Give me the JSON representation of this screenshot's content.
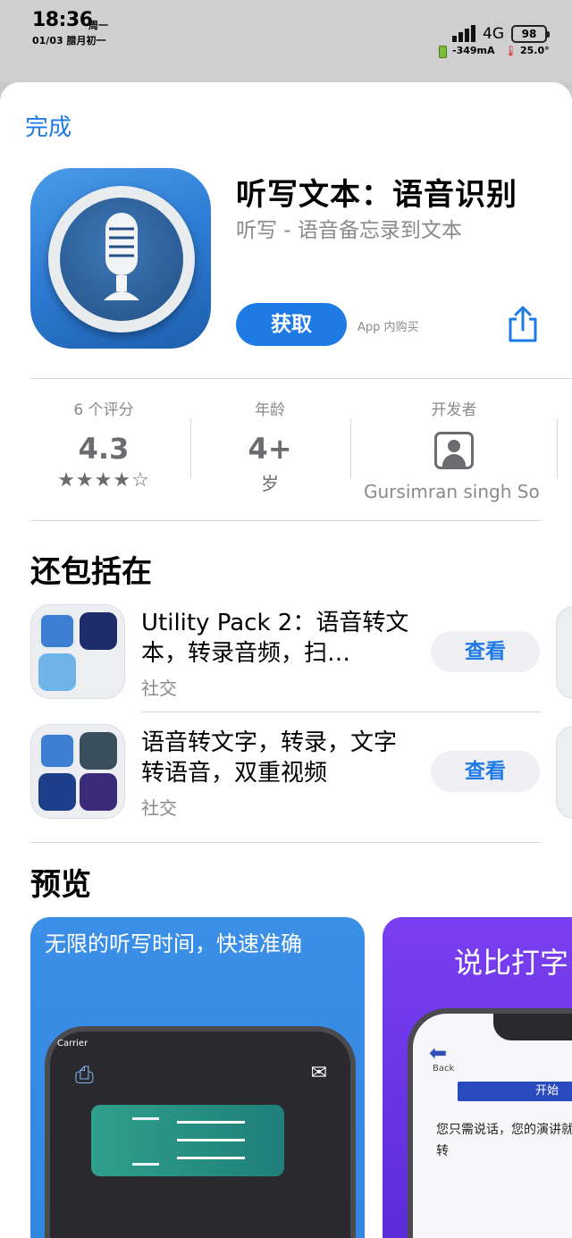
{
  "status_bar": {
    "time": "18:36",
    "weekday": "周一",
    "date": "01/03 腊月初一",
    "network": "4G",
    "battery": "98",
    "current": "-349mA",
    "temperature": "25.0°"
  },
  "header": {
    "done_label": "完成"
  },
  "app": {
    "title": "听写文本：语音识别",
    "subtitle": "听写 - 语音备忘录到文本",
    "get_label": "获取",
    "in_app_purchase": "App 内购买"
  },
  "stats": {
    "ratings": {
      "label": "6 个评分",
      "value": "4.3",
      "stars": "★★★★☆"
    },
    "age": {
      "label": "年龄",
      "value": "4+",
      "sub": "岁"
    },
    "developer": {
      "label": "开发者",
      "name": "Gursimran singh So"
    }
  },
  "bundles": {
    "section_title": "还包括在",
    "items": [
      {
        "title": "Utility Pack 2：语音转文本，转录音频，扫…",
        "category": "社交",
        "button": "查看"
      },
      {
        "title": "语音转文字，转录，文字转语音，双重视频",
        "category": "社交",
        "button": "查看"
      }
    ]
  },
  "preview": {
    "section_title": "预览",
    "screenshots": [
      {
        "caption": "无限的听写时间，快速准确",
        "carrier": "Carrier"
      },
      {
        "caption": "说比打字",
        "back_label": "Back",
        "start_label": "开始",
        "text": "您只需说话，您的演讲就会立即转"
      }
    ]
  },
  "colors": {
    "accent": "#1e7be6",
    "secondary_text": "#8a8a8e"
  }
}
